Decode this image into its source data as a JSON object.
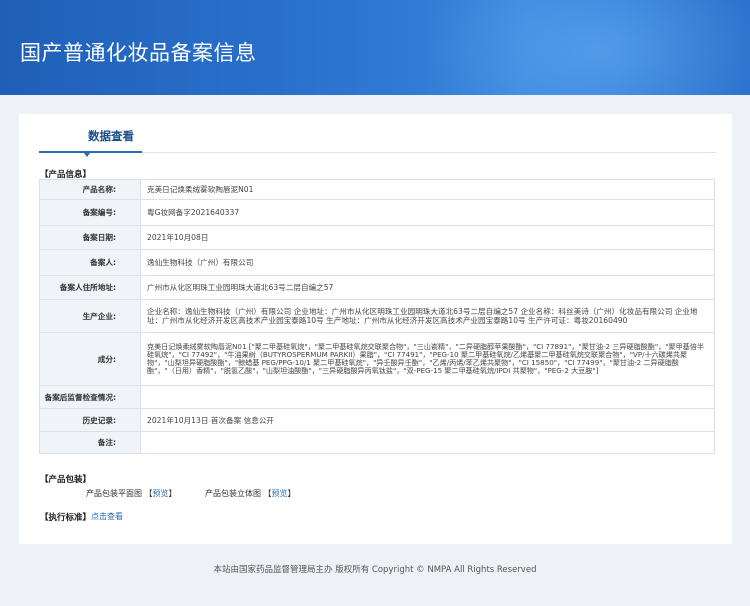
{
  "header": {
    "title": "国产普通化妆品备案信息"
  },
  "tabs": [
    {
      "label": "数据查看"
    }
  ],
  "sections": {
    "product_info": "【产品信息】",
    "packaging": "【产品包装】",
    "standard": "【执行标准】"
  },
  "product": [
    {
      "key": "产品名称:",
      "value": "克美日记焕柔绒雾软陶唇泥N01"
    },
    {
      "key": "备案编号:",
      "value": "粤G妆网备字2021640337"
    },
    {
      "key": "备案日期:",
      "value": "2021年10月08日"
    },
    {
      "key": "备案人:",
      "value": "逸仙生物科技（广州）有限公司"
    },
    {
      "key": "备案人住所地址:",
      "value": "广州市从化区明珠工业园明珠大道北63号二层自编之57"
    },
    {
      "key": "生产企业:",
      "value": "企业名称：逸仙生物科技（广州）有限公司 企业地址：广州市从化区明珠工业园明珠大道北63号二层自编之57 企业名称：科丝美诗（广州）化妆品有限公司 企业地址：广州市从化经济开发区高技术产业园宝泰路10号 生产地址：广州市从化经济开发区高技术产业园宝泰路10号 生产许可证：粤妆20160490"
    },
    {
      "key": "成分:",
      "value": "克美日记焕柔绒雾软陶唇泥N01 [\"聚二甲基硅氧烷\"，\"聚二甲基硅氧烷交联聚合物\"，\"三山嵛精\"，\"二异硬脂醇苹果酸酯\"，\"CI 77891\"，\"聚甘油-2 三异硬脂酸酯\"，\"聚甲基倍半硅氧烷\"，\"CI 77492\"，\"牛油果树（BUTYROSPERMUM PARKII）果脂\"，\"CI 77491\"，\"PEG-10 聚二甲基硅氧烷/乙烯基聚二甲基硅氧烷交联聚合物\"，\"VP/十六碳烯共聚物\"，\"山梨坦异硬脂酸酯\"，\"鲸蜡基 PEG/PPG-10/1 聚二甲基硅氧烷\"，\"异壬酸异壬酯\"，\"乙烯/丙烯/苯乙烯共聚物\"，\"CI 15850\"，\"CI 77499\"，\"聚甘油-2 二异硬脂酸酯\"，\"（日用）香精\"，\"脱氢乙酸\"，\"山梨坦油酸酯\"，\"三异硬脂酸异丙氧钛盐\"，\"双-PEG-15 聚二甲基硅氧烷/IPDI 共聚物\"，\"PEG-2 大豆胺\"]"
    },
    {
      "key": "备案后监督检查情况:",
      "value": ""
    },
    {
      "key": "历史记录:",
      "value": "2021年10月13日 首次备案 信息公开"
    },
    {
      "key": "备注:",
      "value": ""
    }
  ],
  "packaging": {
    "front_label": "产品包装平面图",
    "front_link": "预览",
    "solid_label": "产品包装立体图",
    "solid_link": "预览"
  },
  "standard": {
    "link": "点击查看"
  },
  "footer": {
    "text": "本站由国家药品监督管理局主办 版权所有 Copyright © NMPA All Rights Reserved"
  }
}
